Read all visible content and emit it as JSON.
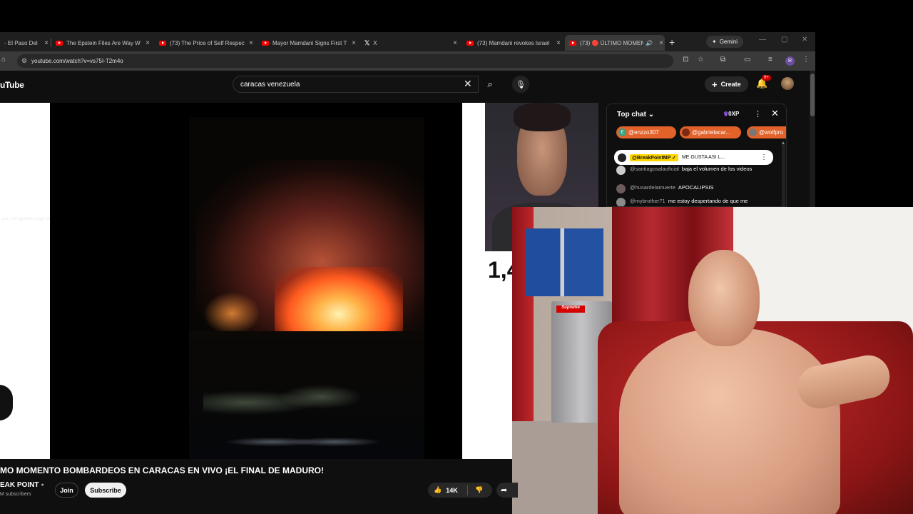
{
  "browser": {
    "tabs": [
      {
        "title": "- El Paso Del"
      },
      {
        "title": "The Epstein Files Are Way W"
      },
      {
        "title": "(73) The Price of Self Respect"
      },
      {
        "title": "Mayor Mamdani Signs First T"
      },
      {
        "title": "X"
      },
      {
        "title": "(73) Mamdani revokes Israel"
      },
      {
        "title": "(73) 🔴 ÚLTIMO MOMEN"
      }
    ],
    "new_tab": "+",
    "gemini_label": "Gemini",
    "url": "youtube.com/watch?v=vs75I-T2m4o",
    "profile_initial": "R"
  },
  "youtube": {
    "logo": "uTube",
    "search_value": "caracas venezuela",
    "create_label": "Create",
    "notif_count": "9+"
  },
  "video": {
    "watermark": "ZEL Immigration Legal Services",
    "overlay_number": "1,4",
    "title": "MO MOMENTO BOMBARDEOS EN CARACAS EN VIVO ¡EL FINAL DE MADURO!",
    "channel": "EAK POINT",
    "subscribers": "M subscribers",
    "join_label": "Join",
    "subscribe_label": "Subscribe",
    "likes": "14K"
  },
  "chat": {
    "title": "Top chat",
    "xp": "0XP",
    "chips": [
      {
        "name": "@enzzo307",
        "initial": "E",
        "color": "#e2622a"
      },
      {
        "name": "@gabrielacar...",
        "initial": "",
        "color": "#e2622a"
      },
      {
        "name": "@wolfpro",
        "initial": "",
        "color": "#e2622a"
      }
    ],
    "pinned": {
      "author": "@BreakPointMP ✓",
      "text": "ME GUSTA ASI L..."
    },
    "messages": [
      {
        "author": "@santiagosalaoficial",
        "text": "baja el volumen de los videos"
      },
      {
        "author": "@husardelamuerte",
        "text": "APOCALIPSIS"
      },
      {
        "author": "@mybrother71",
        "text": "me estoy despertando de que me"
      }
    ]
  },
  "webcam2": {
    "sticker": "Supreme"
  }
}
